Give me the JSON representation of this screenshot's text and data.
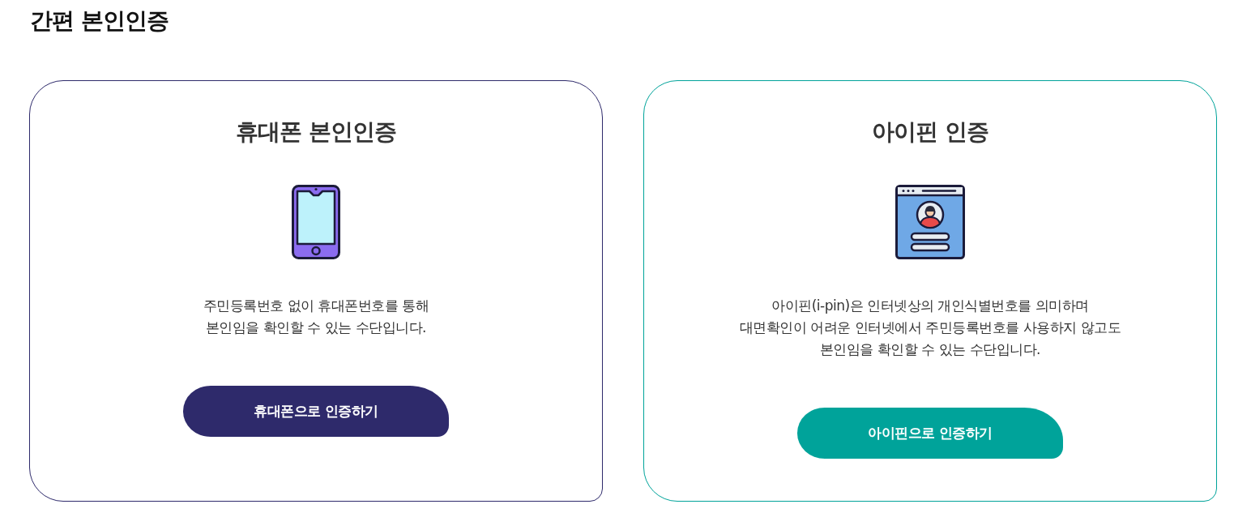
{
  "page": {
    "title": "간편 본인인증"
  },
  "cards": [
    {
      "kind": "phone",
      "color": "#2e2a6b",
      "title": "휴대폰 본인인증",
      "description": "주민등록번호 없이 휴대폰번호를 통해\n본인임을 확인할 수 있는 수단입니다.",
      "button": "휴대폰으로 인증하기"
    },
    {
      "kind": "ipin",
      "color": "#00a39a",
      "title": "아이핀 인증",
      "description": "아이핀(i-pin)은 인터넷상의 개인식별번호를 의미하며\n대면확인이 어려운 인터넷에서 주민등록번호를 사용하지 않고도\n본인임을 확인할 수 있는 수단입니다.",
      "button": "아이핀으로 인증하기"
    }
  ]
}
